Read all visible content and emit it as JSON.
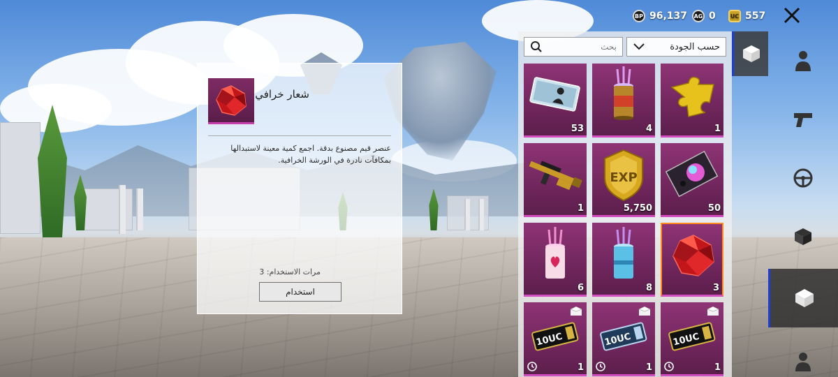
{
  "currencies": [
    {
      "name": "bp",
      "icon": "bp-coin-icon",
      "icon_label": "BP",
      "value": "96,137"
    },
    {
      "name": "ag",
      "icon": "ag-coin-icon",
      "icon_label": "AG",
      "value": "0"
    },
    {
      "name": "uc",
      "icon": "uc-coin-icon",
      "icon_label": "UC",
      "value": "557"
    }
  ],
  "detail": {
    "name": "شعار خرافي",
    "description": "عنصر قيم مصنوع بدقة. اجمع كمية معينة لاستبدالها بمكافآت نادرة في الورشة الخرافية.",
    "uses_label": "مرات الاستخدام:",
    "uses_value": "3",
    "use_button": "استخدام"
  },
  "inventory": {
    "search_placeholder": "بحث",
    "sort_label": "حسب الجودة",
    "items": [
      {
        "icon": "id-card-icon",
        "qty": "53",
        "timed": false,
        "package": false
      },
      {
        "icon": "glowing-can-icon",
        "qty": "4",
        "timed": false,
        "package": false
      },
      {
        "icon": "gold-puzzle-piece-icon",
        "qty": "1",
        "timed": false,
        "package": false
      },
      {
        "icon": "gold-rifle-icon",
        "qty": "1",
        "timed": false,
        "package": false
      },
      {
        "icon": "exp-badge-icon",
        "qty": "5,750",
        "timed": false,
        "package": false
      },
      {
        "icon": "orb-card-icon",
        "qty": "50",
        "timed": false,
        "package": false
      },
      {
        "icon": "heart-can-icon",
        "qty": "6",
        "timed": false,
        "package": false
      },
      {
        "icon": "blue-can-icon",
        "qty": "8",
        "timed": false,
        "package": false
      },
      {
        "icon": "red-gem-emblem-icon",
        "qty": "3",
        "timed": false,
        "package": false,
        "selected": true
      },
      {
        "icon": "uc-voucher-icon",
        "voucher_text": "10UC",
        "qty": "1",
        "timed": true,
        "package": true
      },
      {
        "icon": "uc-voucher-blue-icon",
        "voucher_text": "10UC",
        "qty": "1",
        "timed": true,
        "package": true
      },
      {
        "icon": "uc-voucher-icon",
        "voucher_text": "10UC",
        "qty": "1",
        "timed": true,
        "package": true
      }
    ]
  },
  "colors": {
    "rarity_mythic": "#8f3476",
    "rarity_stripe": "#d24dc0",
    "selection": "#ff8a1f",
    "active_tab": "#1c3fd8"
  }
}
